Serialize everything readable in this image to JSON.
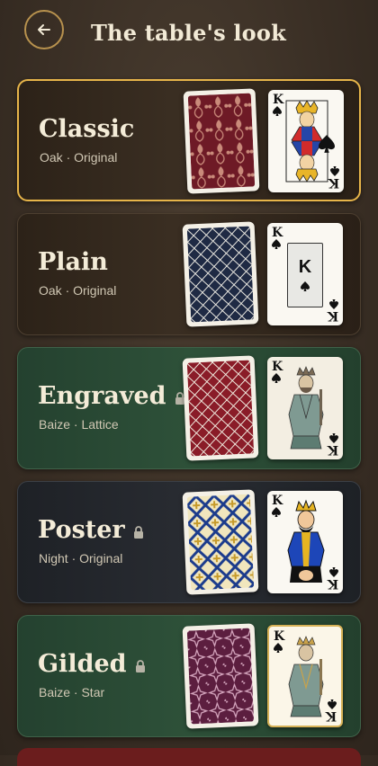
{
  "header": {
    "title": "The table's look",
    "back_icon": "arrow-left-icon"
  },
  "colors": {
    "accent": "#e7b54a",
    "gold_ring": "#b8924e"
  },
  "themes": [
    {
      "name": "Classic",
      "subtitle": "Oak · Original",
      "table": "oak",
      "selected": true,
      "locked": false,
      "back_pattern": "damask-red",
      "face": "classic-king"
    },
    {
      "name": "Plain",
      "subtitle": "Oak · Original",
      "table": "oak",
      "selected": false,
      "locked": false,
      "back_pattern": "lattice-navy",
      "face": "plain-king"
    },
    {
      "name": "Engraved",
      "subtitle": "Baize · Lattice",
      "table": "baize",
      "selected": false,
      "locked": true,
      "back_pattern": "lattice-red",
      "face": "engraved-king"
    },
    {
      "name": "Poster",
      "subtitle": "Night · Original",
      "table": "night",
      "selected": false,
      "locked": true,
      "back_pattern": "tile-blue-gold",
      "face": "poster-king"
    },
    {
      "name": "Gilded",
      "subtitle": "Baize · Star",
      "table": "baize",
      "selected": false,
      "locked": true,
      "back_pattern": "star-plum",
      "face": "gilded-king"
    }
  ],
  "face_rank": "K",
  "lock_icon": "lock-icon"
}
